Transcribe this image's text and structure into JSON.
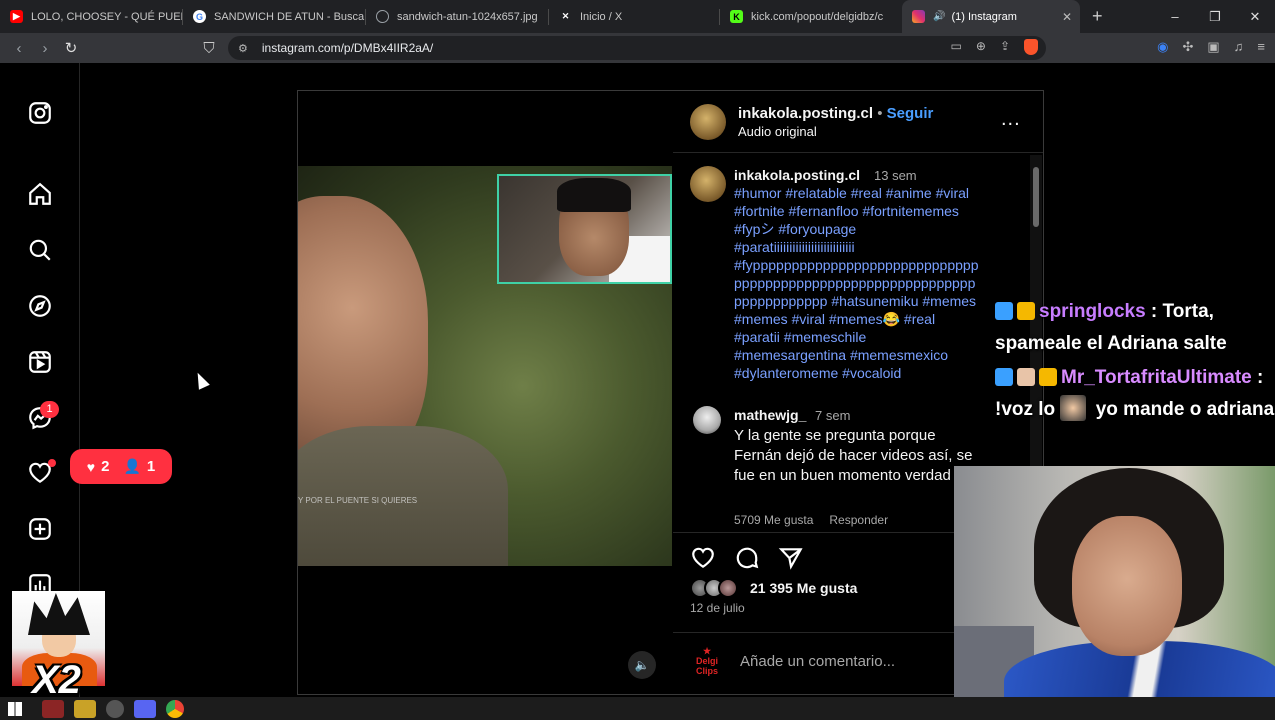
{
  "browser": {
    "tabs": [
      {
        "title": "LOLO, CHOOSEY - QUÉ PUED",
        "icon": "youtube-icon",
        "color": "#ff0000"
      },
      {
        "title": "SANDWICH DE ATUN - Busca",
        "icon": "google-icon",
        "color": "#4285f4"
      },
      {
        "title": "sandwich-atun-1024x657.jpg",
        "icon": "globe-icon",
        "color": "#9aa0a6"
      },
      {
        "title": "Inicio / X",
        "icon": "x-icon",
        "color": "#ffffff"
      },
      {
        "title": "kick.com/popout/delgidbz/c",
        "icon": "kick-icon",
        "color": "#53fc18"
      },
      {
        "title": "(1) Instagram",
        "icon": "instagram-icon",
        "color": "#e1306c"
      }
    ],
    "url": "instagram.com/p/DMBx4IIR2aA/"
  },
  "sidebar": {
    "messages_badge": "1",
    "notification_popup": {
      "likes": "2",
      "followers": "1"
    }
  },
  "post": {
    "username": "inkakola.posting.cl",
    "separator": "•",
    "follow": "Seguir",
    "audio": "Audio original",
    "more": "...",
    "caption_time": "13 sem",
    "caption_lines": [
      "#humor #relatable #real #anime #viral",
      "#fortnite #fernanfloo #fortnitememes",
      "#fypシ #foryoupage",
      "#paratiiiiiiiiiiiiiiiiiiiiiiiiii",
      "#fyppppppppppppppppppppppppppppp",
      "ppppppppppppppppppppppppppppppp",
      "pppppppppppp #hatsunemiku #memes",
      "#memes #viral #memes😂 #real",
      "#paratii #memeschile",
      "#memesargentina #memesmexico",
      "#dylanteromeme #vocaloid"
    ],
    "video_caption": "Y POR EL PUENTE SI QUIERES",
    "comment": {
      "username": "mathewjg_",
      "time": "7 sem",
      "text": "Y la gente se pregunta porque Fernán dejó de hacer videos así, se fue en un buen momento verdad XD",
      "likes": "5709 Me gusta",
      "reply": "Responder"
    },
    "likes": "21 395 Me gusta",
    "date": "12 de julio",
    "add_comment": "Añade un comentario..."
  },
  "overlay": {
    "chat": [
      {
        "user": "springlocks",
        "sep": " : ",
        "text": "Torta, spameale el Adriana salte"
      },
      {
        "user": "Mr_TortafritaUltimate",
        "sep": " : ",
        "text_a": "!voz lo",
        "text_b": "yo mande o adriana"
      }
    ],
    "goku_label": "X2"
  }
}
